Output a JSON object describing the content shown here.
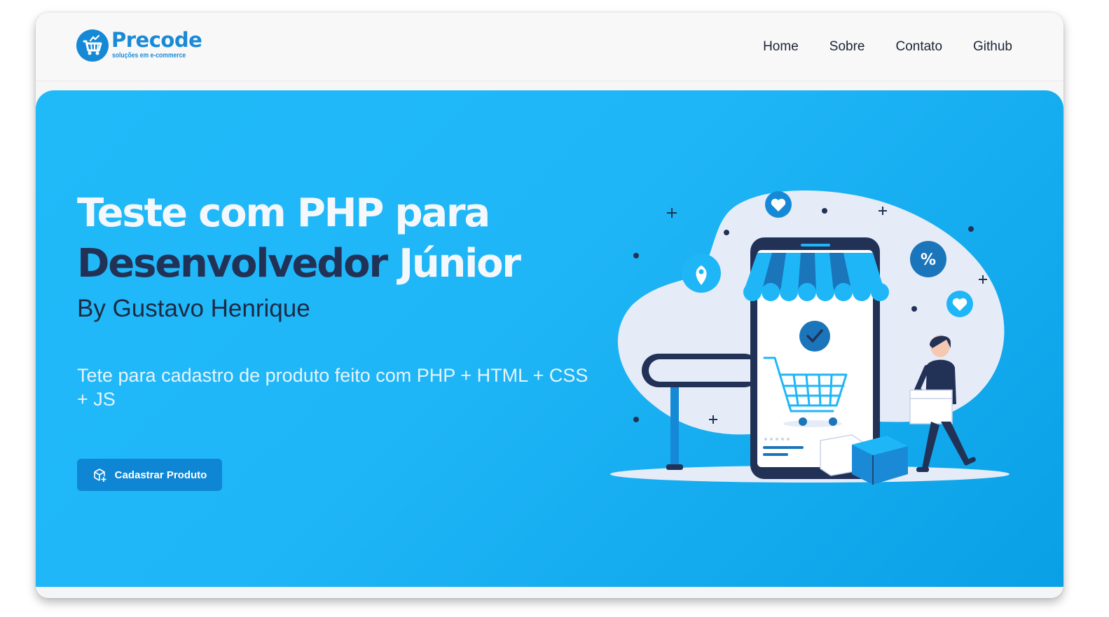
{
  "brand": {
    "name": "Precode",
    "tagline": "soluções em e-commerce",
    "logo_icon": "shopping-basket-icon",
    "color": "#1a8ad6"
  },
  "nav": {
    "items": [
      {
        "label": "Home"
      },
      {
        "label": "Sobre"
      },
      {
        "label": "Contato"
      },
      {
        "label": "Github"
      }
    ]
  },
  "hero": {
    "title_line1": "Teste com PHP para",
    "title_line2_dark": "Desenvolvedor",
    "title_line2_light": "Júnior",
    "byline": "By Gustavo Henrique",
    "description": "Tete para cadastro de produto feito com PHP + HTML + CSS + JS",
    "cta_label": "Cadastrar Produto",
    "cta_icon": "package-plus-icon",
    "illustration": "online-shop-illustration",
    "colors": {
      "background": "#20baf9",
      "title_dark": "#223256",
      "button": "#0f86d3"
    }
  }
}
